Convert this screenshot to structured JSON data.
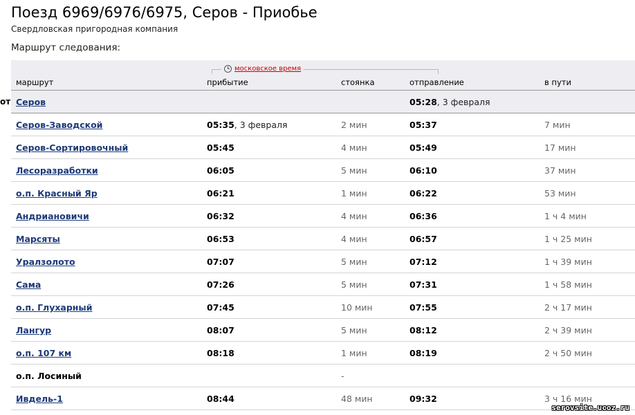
{
  "page": {
    "title": "Поезд 6969/6976/6975, Серов - Приобье",
    "subtitle": "Свердловская пригородная компания",
    "route_label": "Маршрут следования:",
    "side_mark": "от"
  },
  "table": {
    "timezone_label": "московское время",
    "headers": {
      "route": "маршрут",
      "arrival": "прибытие",
      "stop": "стоянка",
      "departure": "отправление",
      "travel": "в пути"
    },
    "rows": [
      {
        "station": "Серов",
        "link": true,
        "arr": "",
        "arr_date": "",
        "stop": "",
        "dep": "05:28",
        "dep_date": ", 3 февраля",
        "travel": ""
      },
      {
        "station": "Серов-Заводской",
        "link": true,
        "arr": "05:35",
        "arr_date": ", 3 февраля",
        "stop": "2 мин",
        "dep": "05:37",
        "dep_date": "",
        "travel": "7 мин"
      },
      {
        "station": "Серов-Сортировочный",
        "link": true,
        "arr": "05:45",
        "arr_date": "",
        "stop": "4 мин",
        "dep": "05:49",
        "dep_date": "",
        "travel": "17 мин"
      },
      {
        "station": "Лесоразработки",
        "link": true,
        "arr": "06:05",
        "arr_date": "",
        "stop": "5 мин",
        "dep": "06:10",
        "dep_date": "",
        "travel": "37 мин"
      },
      {
        "station": "о.п. Красный Яр",
        "link": true,
        "arr": "06:21",
        "arr_date": "",
        "stop": "1 мин",
        "dep": "06:22",
        "dep_date": "",
        "travel": "53 мин"
      },
      {
        "station": "Андриановичи",
        "link": true,
        "arr": "06:32",
        "arr_date": "",
        "stop": "4 мин",
        "dep": "06:36",
        "dep_date": "",
        "travel": "1 ч 4 мин"
      },
      {
        "station": "Марсяты",
        "link": true,
        "arr": "06:53",
        "arr_date": "",
        "stop": "4 мин",
        "dep": "06:57",
        "dep_date": "",
        "travel": "1 ч 25 мин"
      },
      {
        "station": "Уралзолото",
        "link": true,
        "arr": "07:07",
        "arr_date": "",
        "stop": "5 мин",
        "dep": "07:12",
        "dep_date": "",
        "travel": "1 ч 39 мин"
      },
      {
        "station": "Сама",
        "link": true,
        "arr": "07:26",
        "arr_date": "",
        "stop": "5 мин",
        "dep": "07:31",
        "dep_date": "",
        "travel": "1 ч 58 мин"
      },
      {
        "station": "о.п. Глухарный",
        "link": true,
        "arr": "07:45",
        "arr_date": "",
        "stop": "10 мин",
        "dep": "07:55",
        "dep_date": "",
        "travel": "2 ч 17 мин"
      },
      {
        "station": "Лангур",
        "link": true,
        "arr": "08:07",
        "arr_date": "",
        "stop": "5 мин",
        "dep": "08:12",
        "dep_date": "",
        "travel": "2 ч 39 мин"
      },
      {
        "station": "о.п. 107 км",
        "link": true,
        "arr": "08:18",
        "arr_date": "",
        "stop": "1 мин",
        "dep": "08:19",
        "dep_date": "",
        "travel": "2 ч 50 мин"
      },
      {
        "station": "о.п. Лосиный",
        "link": false,
        "arr": "",
        "arr_date": "",
        "stop": "-",
        "dep": "",
        "dep_date": "",
        "travel": ""
      },
      {
        "station": "Ивдель-1",
        "link": true,
        "arr": "08:44",
        "arr_date": "",
        "stop": "48 мин",
        "dep": "09:32",
        "dep_date": "",
        "travel": "3 ч 16 мин"
      }
    ]
  },
  "watermark": "serovsite.ucoz.ru",
  "colors": {
    "link": "#1c3a78",
    "header_bg": "#eeeef2",
    "timezone": "#c00000",
    "muted": "#666666"
  }
}
